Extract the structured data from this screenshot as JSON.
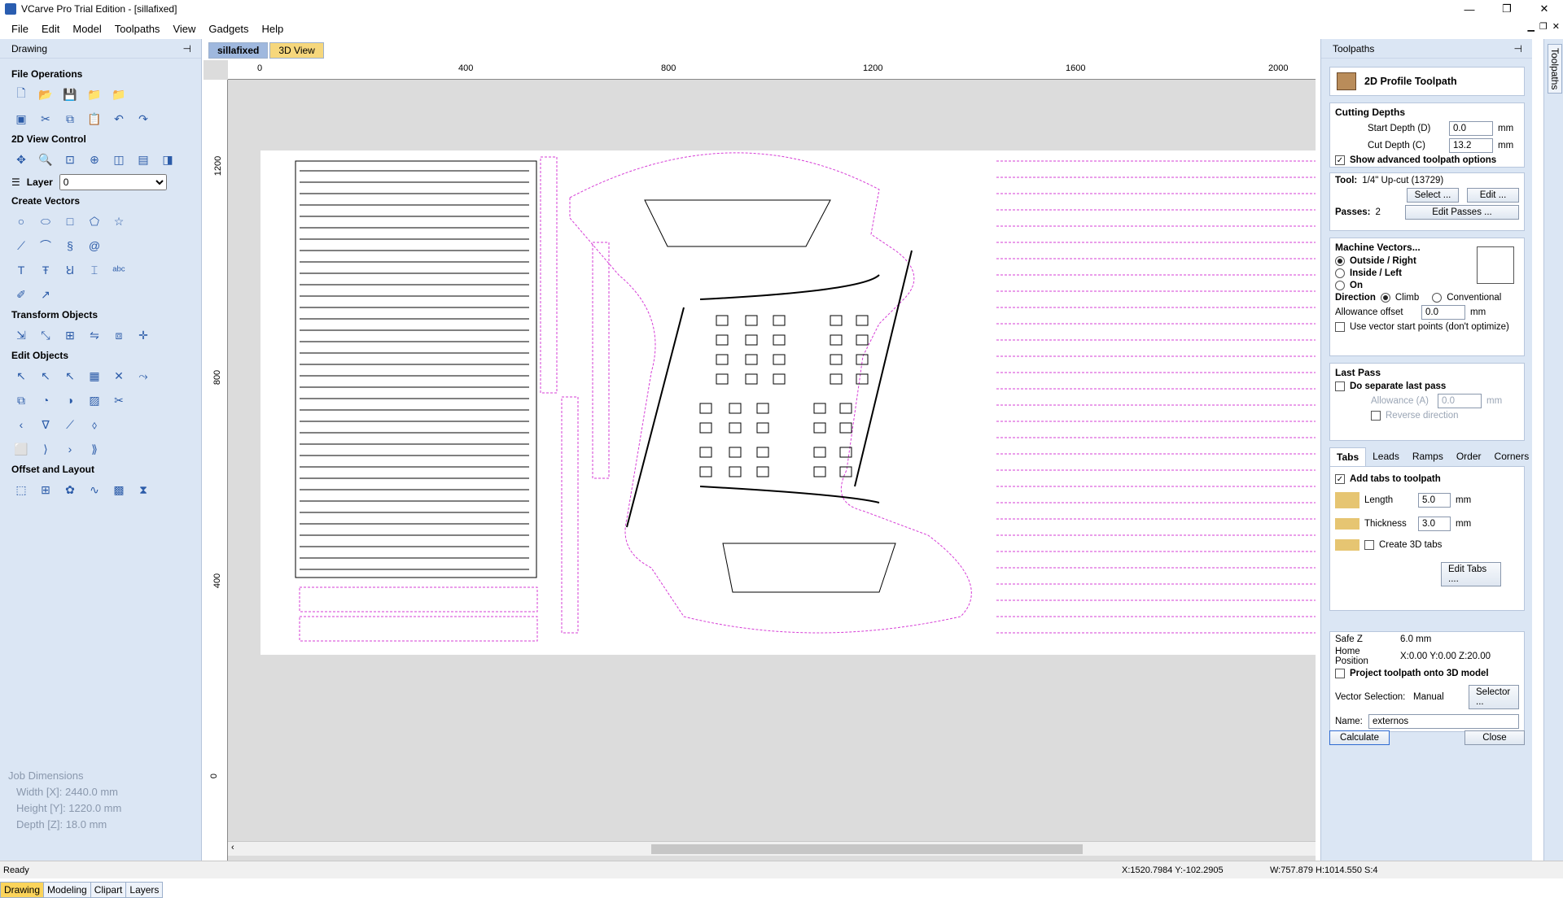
{
  "app": {
    "title": "VCarve Pro Trial Edition - [sillafixed]",
    "controls": {
      "minimize": "—",
      "maximize": "❐",
      "close": "✕"
    }
  },
  "menu": [
    "File",
    "Edit",
    "Model",
    "Toolpaths",
    "View",
    "Gadgets",
    "Help"
  ],
  "left": {
    "panel_title": "Drawing",
    "sections": {
      "file_ops": "File Operations",
      "view_control": "2D View Control",
      "layer_label": "Layer",
      "layer_value": "0",
      "create_vectors": "Create Vectors",
      "transform": "Transform Objects",
      "edit_objects": "Edit Objects",
      "offset_layout": "Offset and Layout"
    },
    "job": {
      "title": "Job Dimensions",
      "width": "Width  [X]: 2440.0 mm",
      "height": "Height [Y]: 1220.0 mm",
      "depth": "Depth  [Z]: 18.0 mm"
    },
    "tabs": [
      "Drawing",
      "Modeling",
      "Clipart",
      "Layers"
    ]
  },
  "doc": {
    "tabs": [
      "sillafixed",
      "3D View"
    ],
    "ruler_x": [
      "0",
      "400",
      "800",
      "1200",
      "1600",
      "2000"
    ],
    "ruler_y": [
      "1200",
      "800",
      "400",
      "0"
    ]
  },
  "right": {
    "panel_title": "Toolpaths",
    "side_tab": "Toolpaths",
    "header": "2D Profile Toolpath",
    "cutting": {
      "title": "Cutting Depths",
      "start_label": "Start Depth (D)",
      "start_value": "0.0",
      "cut_label": "Cut Depth (C)",
      "cut_value": "13.2",
      "unit": "mm",
      "advanced": "Show advanced toolpath options"
    },
    "tool": {
      "label": "Tool:",
      "name": "1/4\" Up-cut (13729)",
      "select": "Select ...",
      "edit": "Edit ...",
      "passes_label": "Passes:",
      "passes_value": "2",
      "edit_passes": "Edit Passes ..."
    },
    "machine": {
      "title": "Machine Vectors...",
      "outside": "Outside / Right",
      "inside": "Inside / Left",
      "on": "On",
      "direction": "Direction",
      "climb": "Climb",
      "conventional": "Conventional",
      "allowance_label": "Allowance offset",
      "allowance_value": "0.0",
      "unit": "mm",
      "use_vector": "Use vector start points (don't optimize)"
    },
    "lastpass": {
      "title": "Last Pass",
      "separate": "Do separate last pass",
      "allowance_label": "Allowance (A)",
      "allowance_value": "0.0",
      "unit": "mm",
      "reverse": "Reverse direction"
    },
    "tabs": {
      "strip": [
        "Tabs",
        "Leads",
        "Ramps",
        "Order",
        "Corners"
      ],
      "add": "Add tabs to toolpath",
      "length_label": "Length",
      "length_value": "5.0",
      "thickness_label": "Thickness",
      "thickness_value": "3.0",
      "unit": "mm",
      "create3d": "Create 3D tabs",
      "edit_tabs": "Edit Tabs ...."
    },
    "footer": {
      "safez_label": "Safe Z",
      "safez_value": "6.0 mm",
      "home_label": "Home Position",
      "home_value": "X:0.00 Y:0.00 Z:20.00",
      "project": "Project toolpath onto 3D model",
      "vecsel_label": "Vector Selection:",
      "vecsel_value": "Manual",
      "selector": "Selector ...",
      "name_label": "Name:",
      "name_value": "externos",
      "calculate": "Calculate",
      "close": "Close"
    }
  },
  "status": {
    "left": "Ready",
    "coords": "X:1520.7984 Y:-102.2905",
    "dims": "W:757.879  H:1014.550  S:4"
  }
}
